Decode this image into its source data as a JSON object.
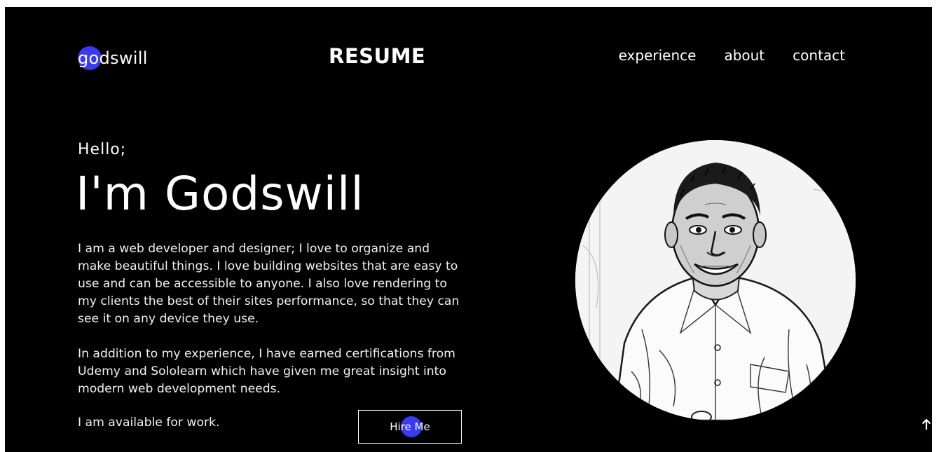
{
  "header": {
    "logo_text": "godswill",
    "brand_title": "RESUME",
    "nav": [
      {
        "label": "experience"
      },
      {
        "label": "about"
      },
      {
        "label": "contact"
      }
    ]
  },
  "hero": {
    "greeting": "Hello;",
    "headline": "I'm Godswill",
    "bio_paragraph_1": "I am a web developer and designer; I love to organize and make beautiful things. I love building websites that are easy to use and can be accessible to anyone. I also love rendering to my clients the best of their sites performance, so that they can see it on any device they use.",
    "bio_paragraph_2": "In addition to my experience, I have earned certifications from Udemy and Sololearn which have given me great insight into modern web development needs.",
    "availability": "I am available for work.",
    "hire_button": "Hire Me"
  },
  "portrait": {
    "icon": "profile-photo"
  },
  "colors": {
    "background": "#000000",
    "text": "#ffffff",
    "accent": "#3a3af4"
  },
  "icons": {
    "scroll_top": "arrow-up-icon"
  }
}
